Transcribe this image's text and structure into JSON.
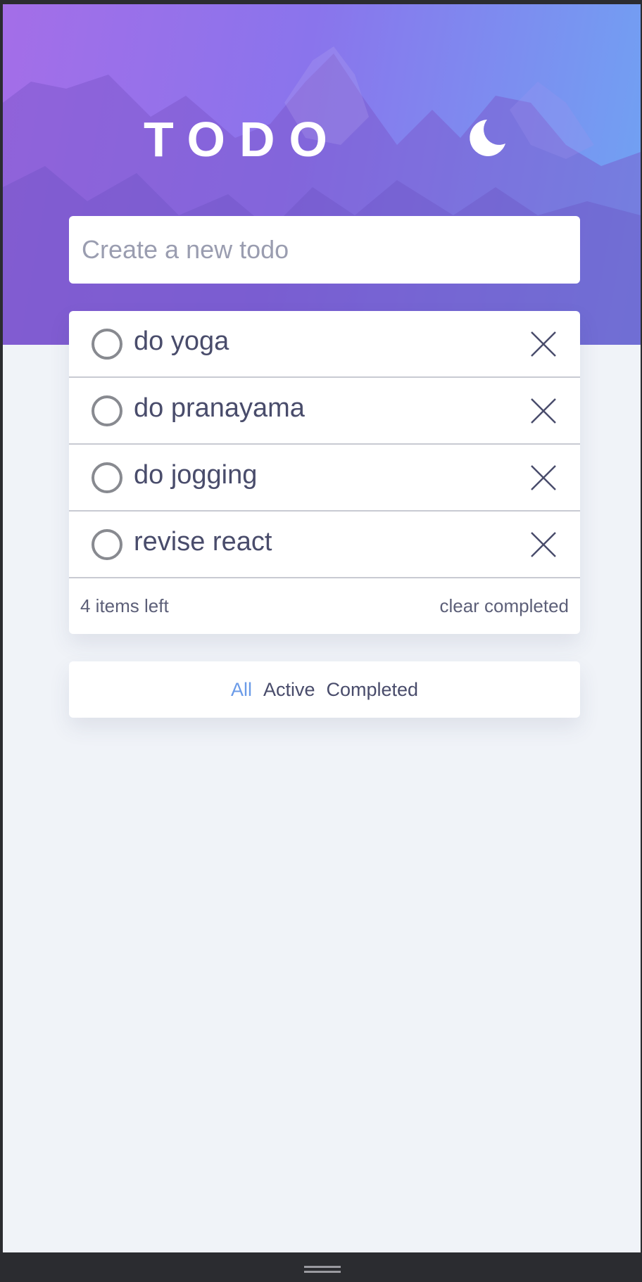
{
  "header": {
    "title": "TODO",
    "theme_toggle_icon": "moon-icon"
  },
  "new_todo": {
    "placeholder": "Create a new todo",
    "value": ""
  },
  "todos": [
    {
      "text": "do yoga",
      "completed": false
    },
    {
      "text": "do pranayama",
      "completed": false
    },
    {
      "text": "do jogging",
      "completed": false
    },
    {
      "text": "revise react",
      "completed": false
    }
  ],
  "footer": {
    "items_left": "4 items left",
    "clear_completed": "clear completed"
  },
  "filters": {
    "all": "All",
    "active": "Active",
    "completed": "Completed",
    "selected": "all"
  },
  "colors": {
    "accent": "#6b9be8",
    "text": "#494c6b",
    "background": "#f0f3f8",
    "card": "#ffffff"
  }
}
